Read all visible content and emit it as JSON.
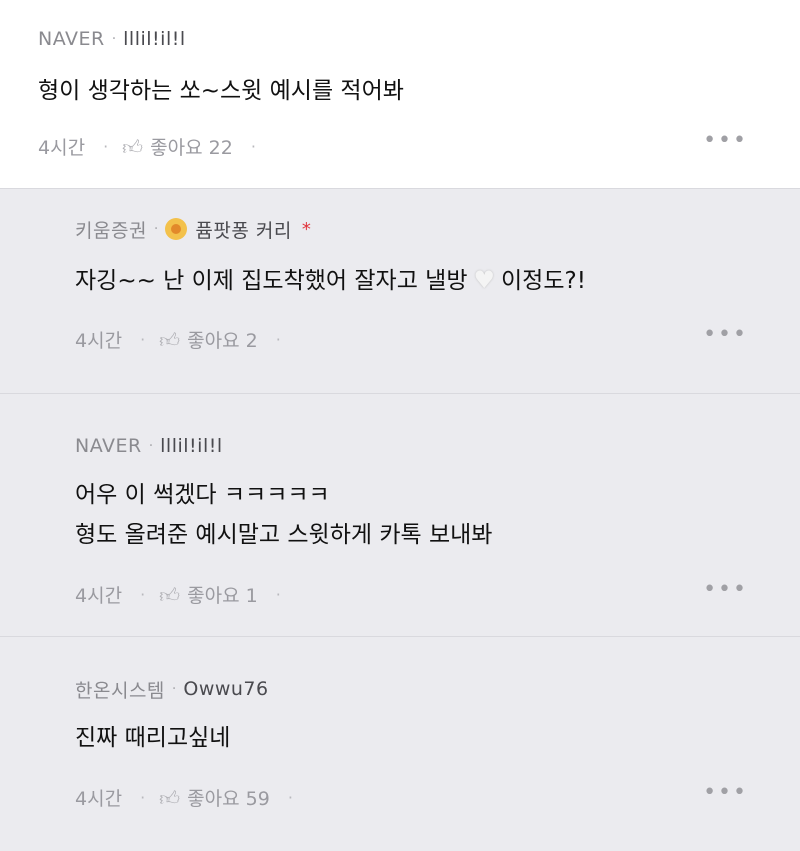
{
  "comments": [
    {
      "author": "NAVER",
      "nick": "lllil!il!l",
      "text": "형이 생각하는 쏘~스윗 예시를 적어봐",
      "time": "4시간",
      "likes_label": "좋아요 22"
    },
    {
      "author": "키움증권",
      "nick": "퓸팟퐁 커리",
      "text_before": "자깅~~ 난 이제 집도착했어 잘자고 낼방",
      "text_after": "이정도?!",
      "time": "4시간",
      "likes_label": "좋아요 2"
    },
    {
      "author": "NAVER",
      "nick": "lllil!il!l",
      "line1": "어우 이 썩겠다 ㅋㅋㅋㅋㅋ",
      "line2": "형도 올려준 예시말고 스윗하게 카톡 보내봐",
      "time": "4시간",
      "likes_label": "좋아요 1"
    },
    {
      "author": "한온시스템",
      "nick": "Owwu76",
      "text": "진짜 때리고싶네",
      "time": "4시간",
      "likes_label": "좋아요 59"
    }
  ],
  "icons": {
    "like": "thumbs-up-icon",
    "more": "more-dots-icon",
    "heart": "white-heart-icon"
  },
  "colors": {
    "badge_accent": "#f3c14b",
    "star": "#e0323a",
    "reply_bg": "#ebebef"
  }
}
